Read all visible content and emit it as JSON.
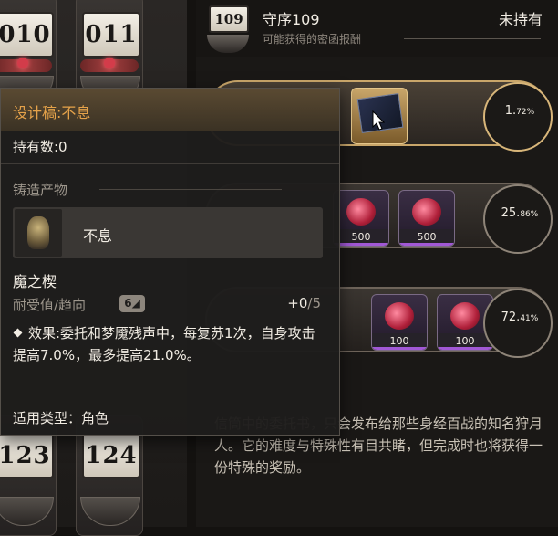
{
  "left_badges": [
    {
      "number": "010"
    },
    {
      "number": "011"
    },
    {
      "number": "123"
    },
    {
      "number": "124"
    }
  ],
  "header": {
    "badge_number": "109",
    "title": "守序109",
    "status": "未持有",
    "subtitle": "可能获得的密函报酬"
  },
  "rewards": [
    {
      "percent": "1.",
      "percent_small": "72%",
      "tier": "gold"
    },
    {
      "percent": "25.",
      "percent_small": "86%",
      "quantities": [
        "500",
        "500"
      ]
    },
    {
      "percent": "72.",
      "percent_small": "41%",
      "quantities": [
        "100",
        "100"
      ]
    }
  ],
  "description": "信筒中的委托书，只会发布给那些身经百战的知名狩月人。它的难度与特殊性有目共睹，但完成时也将获得一份特殊的奖励。",
  "tooltip": {
    "title": "设计稿:不息",
    "owned": "持有数:0",
    "section_label": "铸造产物",
    "product_name": "不息",
    "item_name": "魔之楔",
    "tolerance_label": "耐受值/趋向",
    "tolerance_icon": "6",
    "count_value": "+0",
    "count_max": "/5",
    "effect": "效果:委托和梦魇残声中，每复苏1次，自身攻击提高7.0%，最多提高21.0%。",
    "applicable_type": "适用类型：角色"
  },
  "colors": {
    "accent_gold": "#e6a34a",
    "rare_purple": "#a158d6"
  }
}
